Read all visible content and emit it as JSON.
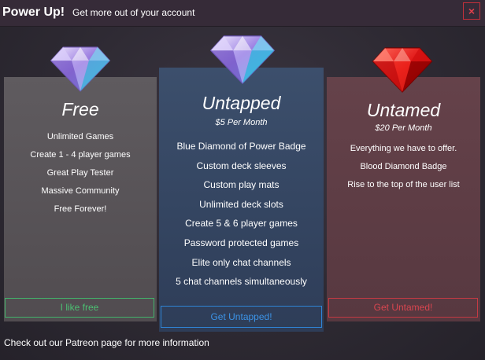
{
  "header": {
    "title": "Power Up!",
    "subtitle": "Get more out of your account",
    "close_label": "×"
  },
  "tiers": {
    "free": {
      "name": "Free",
      "price": "",
      "features": [
        "Unlimited Games",
        "Create 1 - 4 player games",
        "Great Play Tester",
        "Massive Community",
        "Free Forever!"
      ],
      "cta": "I like free",
      "accent": "#43b36b",
      "gem_icon": "purple-diamond-icon"
    },
    "untapped": {
      "name": "Untapped",
      "price": "$5 Per Month",
      "features": [
        "Blue Diamond of Power Badge",
        "Custom deck sleeves",
        "Custom play mats",
        "Unlimited deck slots",
        "Create 5 & 6 player games",
        "Password protected games",
        "Elite only chat channels",
        "5 chat channels simultaneously"
      ],
      "cta": "Get Untapped!",
      "accent": "#2f84d6",
      "gem_icon": "blue-diamond-icon"
    },
    "untamed": {
      "name": "Untamed",
      "price": "$20 Per Month",
      "features": [
        "Everything we have to offer.",
        "Blood Diamond Badge",
        "Rise to the top of the user list"
      ],
      "cta": "Get Untamed!",
      "accent": "#c53a43",
      "gem_icon": "red-diamond-icon"
    }
  },
  "footer": {
    "text": "Check out our Patreon page for more information"
  }
}
